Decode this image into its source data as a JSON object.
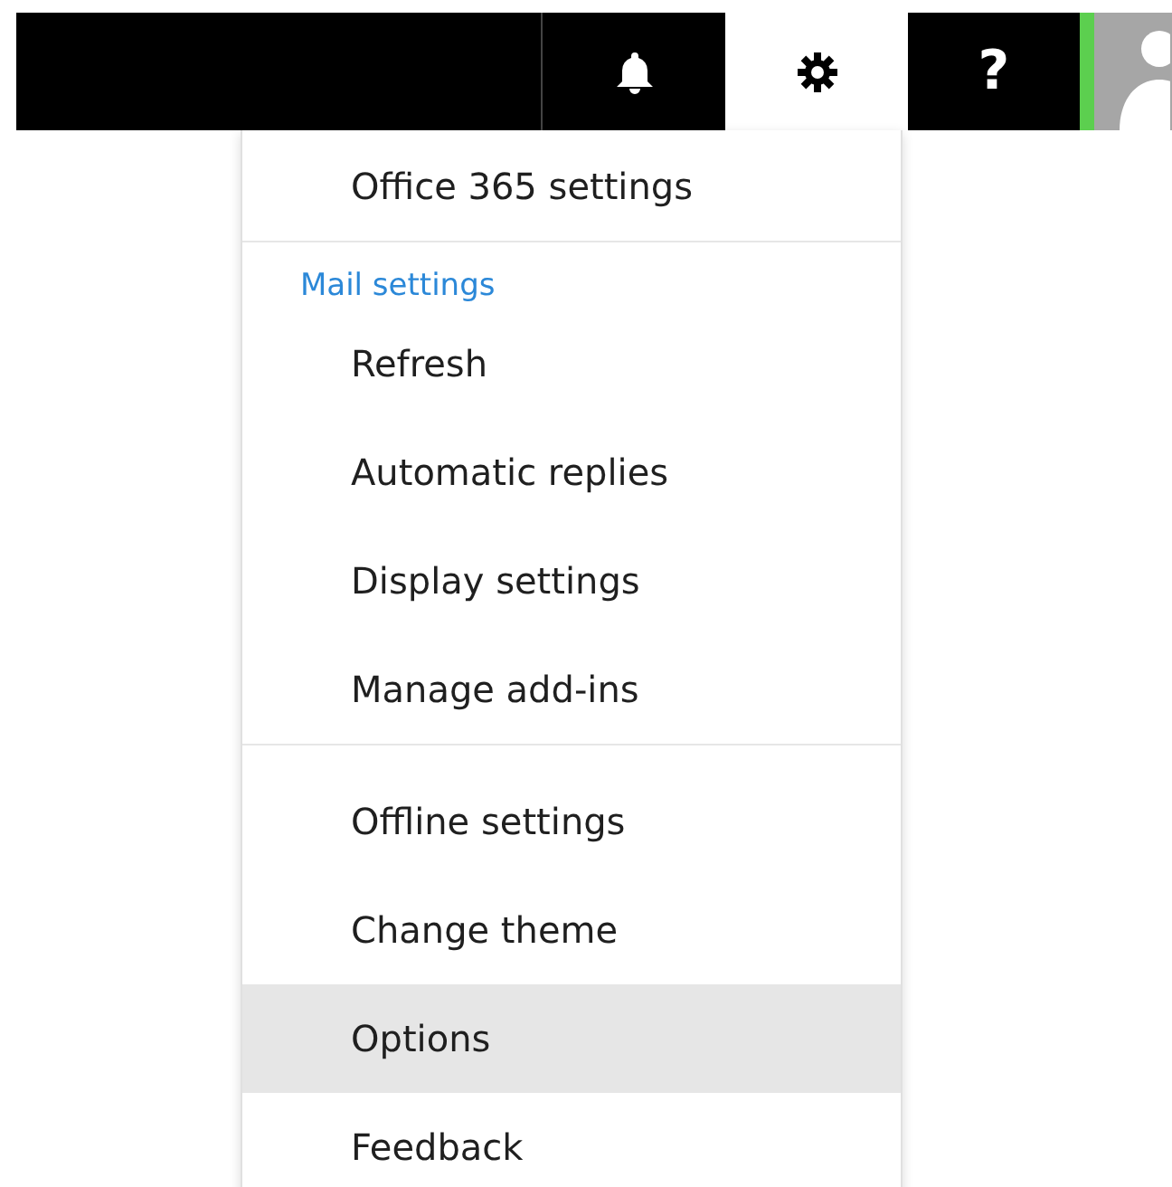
{
  "toolbar": {
    "buttons": [
      {
        "kind": "bell",
        "selected": false
      },
      {
        "kind": "gear",
        "selected": true
      },
      {
        "kind": "help",
        "label": "?",
        "selected": false
      }
    ]
  },
  "menu": {
    "sections": [
      {
        "items": [
          {
            "label": "Office 365 settings",
            "selected": false
          }
        ]
      },
      {
        "header": "Mail settings",
        "items": [
          {
            "label": "Refresh",
            "selected": false
          },
          {
            "label": "Automatic replies",
            "selected": false
          },
          {
            "label": "Display settings",
            "selected": false
          },
          {
            "label": "Manage add-ins",
            "selected": false
          }
        ]
      },
      {
        "items": [
          {
            "label": "Offline settings",
            "selected": false
          },
          {
            "label": "Change theme",
            "selected": false
          },
          {
            "label": "Options",
            "selected": true
          },
          {
            "label": "Feedback",
            "selected": false
          }
        ]
      }
    ]
  }
}
